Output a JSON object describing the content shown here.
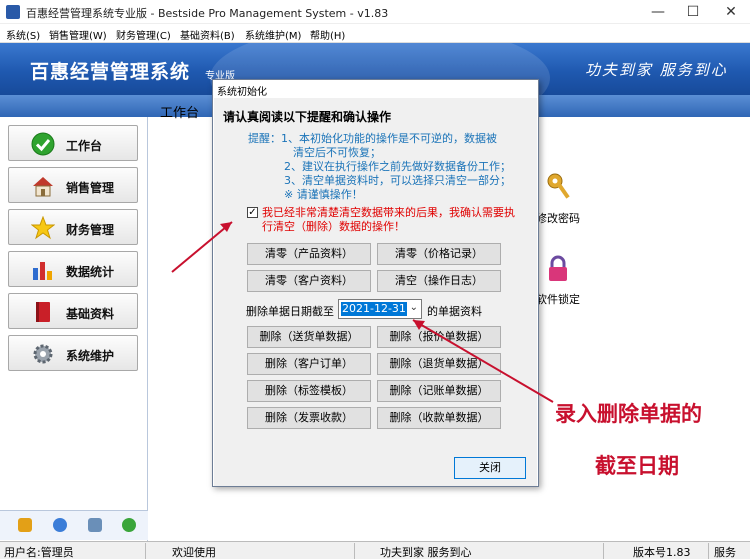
{
  "window": {
    "title": "百惠经营管理系统专业版 - Bestside Pro Management System - v1.83",
    "minimize": "—",
    "maximize": "☐",
    "close": "✕"
  },
  "menu": [
    "系统(S)",
    "销售管理(W)",
    "财务管理(C)",
    "基础资料(B)",
    "系统维护(M)",
    "帮助(H)"
  ],
  "banner": {
    "logo": "百惠经营管理系统",
    "logo_sub": "专业版",
    "slogan": "功夫到家 服务到心"
  },
  "nav": [
    {
      "label": "工作台",
      "icon": "check-icon"
    },
    {
      "label": "销售管理",
      "icon": "house-icon"
    },
    {
      "label": "财务管理",
      "icon": "star-icon"
    },
    {
      "label": "数据统计",
      "icon": "bar-chart-icon"
    },
    {
      "label": "基础资料",
      "icon": "book-icon"
    },
    {
      "label": "系统维护",
      "icon": "gear-icon"
    }
  ],
  "main": {
    "workspace_label": "工作台",
    "tiles": [
      {
        "label": "修改密码",
        "icon": "key-icon"
      },
      {
        "label": "软件锁定",
        "icon": "lock-icon"
      }
    ]
  },
  "dialog": {
    "title": "系统初始化",
    "warning_heading": "请认真阅读以下提醒和确认操作",
    "notice_lines": [
      "提醒：1、本初始化功能的操作是不可逆的，数据被",
      "清空后不可恢复；",
      "2、建议在执行操作之前先做好数据备份工作；",
      "3、清空单据资料时，可以选择只清空一部分；",
      "※ 请谨慎操作！"
    ],
    "confirm_checked": true,
    "confirm_text": "我已经非常清楚清空数据带来的后果，我确认需要执行清空（删除）数据的操作！",
    "clear_buttons": [
      "清零（产品资料）",
      "清零（价格记录）",
      "清零（客户资料）",
      "清空（操作日志）"
    ],
    "date_label": "删除单据日期截至",
    "date_value": "2021-12-31",
    "date_suffix": "的单据资料",
    "delete_buttons": [
      "删除（送货单数据）",
      "删除（报价单数据）",
      "删除（客户订单）",
      "删除（退货单数据）",
      "删除（标签模板）",
      "删除（记账单数据）",
      "删除（发票收款）",
      "删除（收款单数据）"
    ],
    "close_label": "关闭"
  },
  "annotation": {
    "line1": "录入删除单据的",
    "line2": "截至日期",
    "color": "#c8102e"
  },
  "status": {
    "user": "用户名:管理员",
    "welcome": "欢迎使用",
    "slogan": "功夫到家 服务到心",
    "version": "版本号1.83",
    "service": "服务"
  }
}
